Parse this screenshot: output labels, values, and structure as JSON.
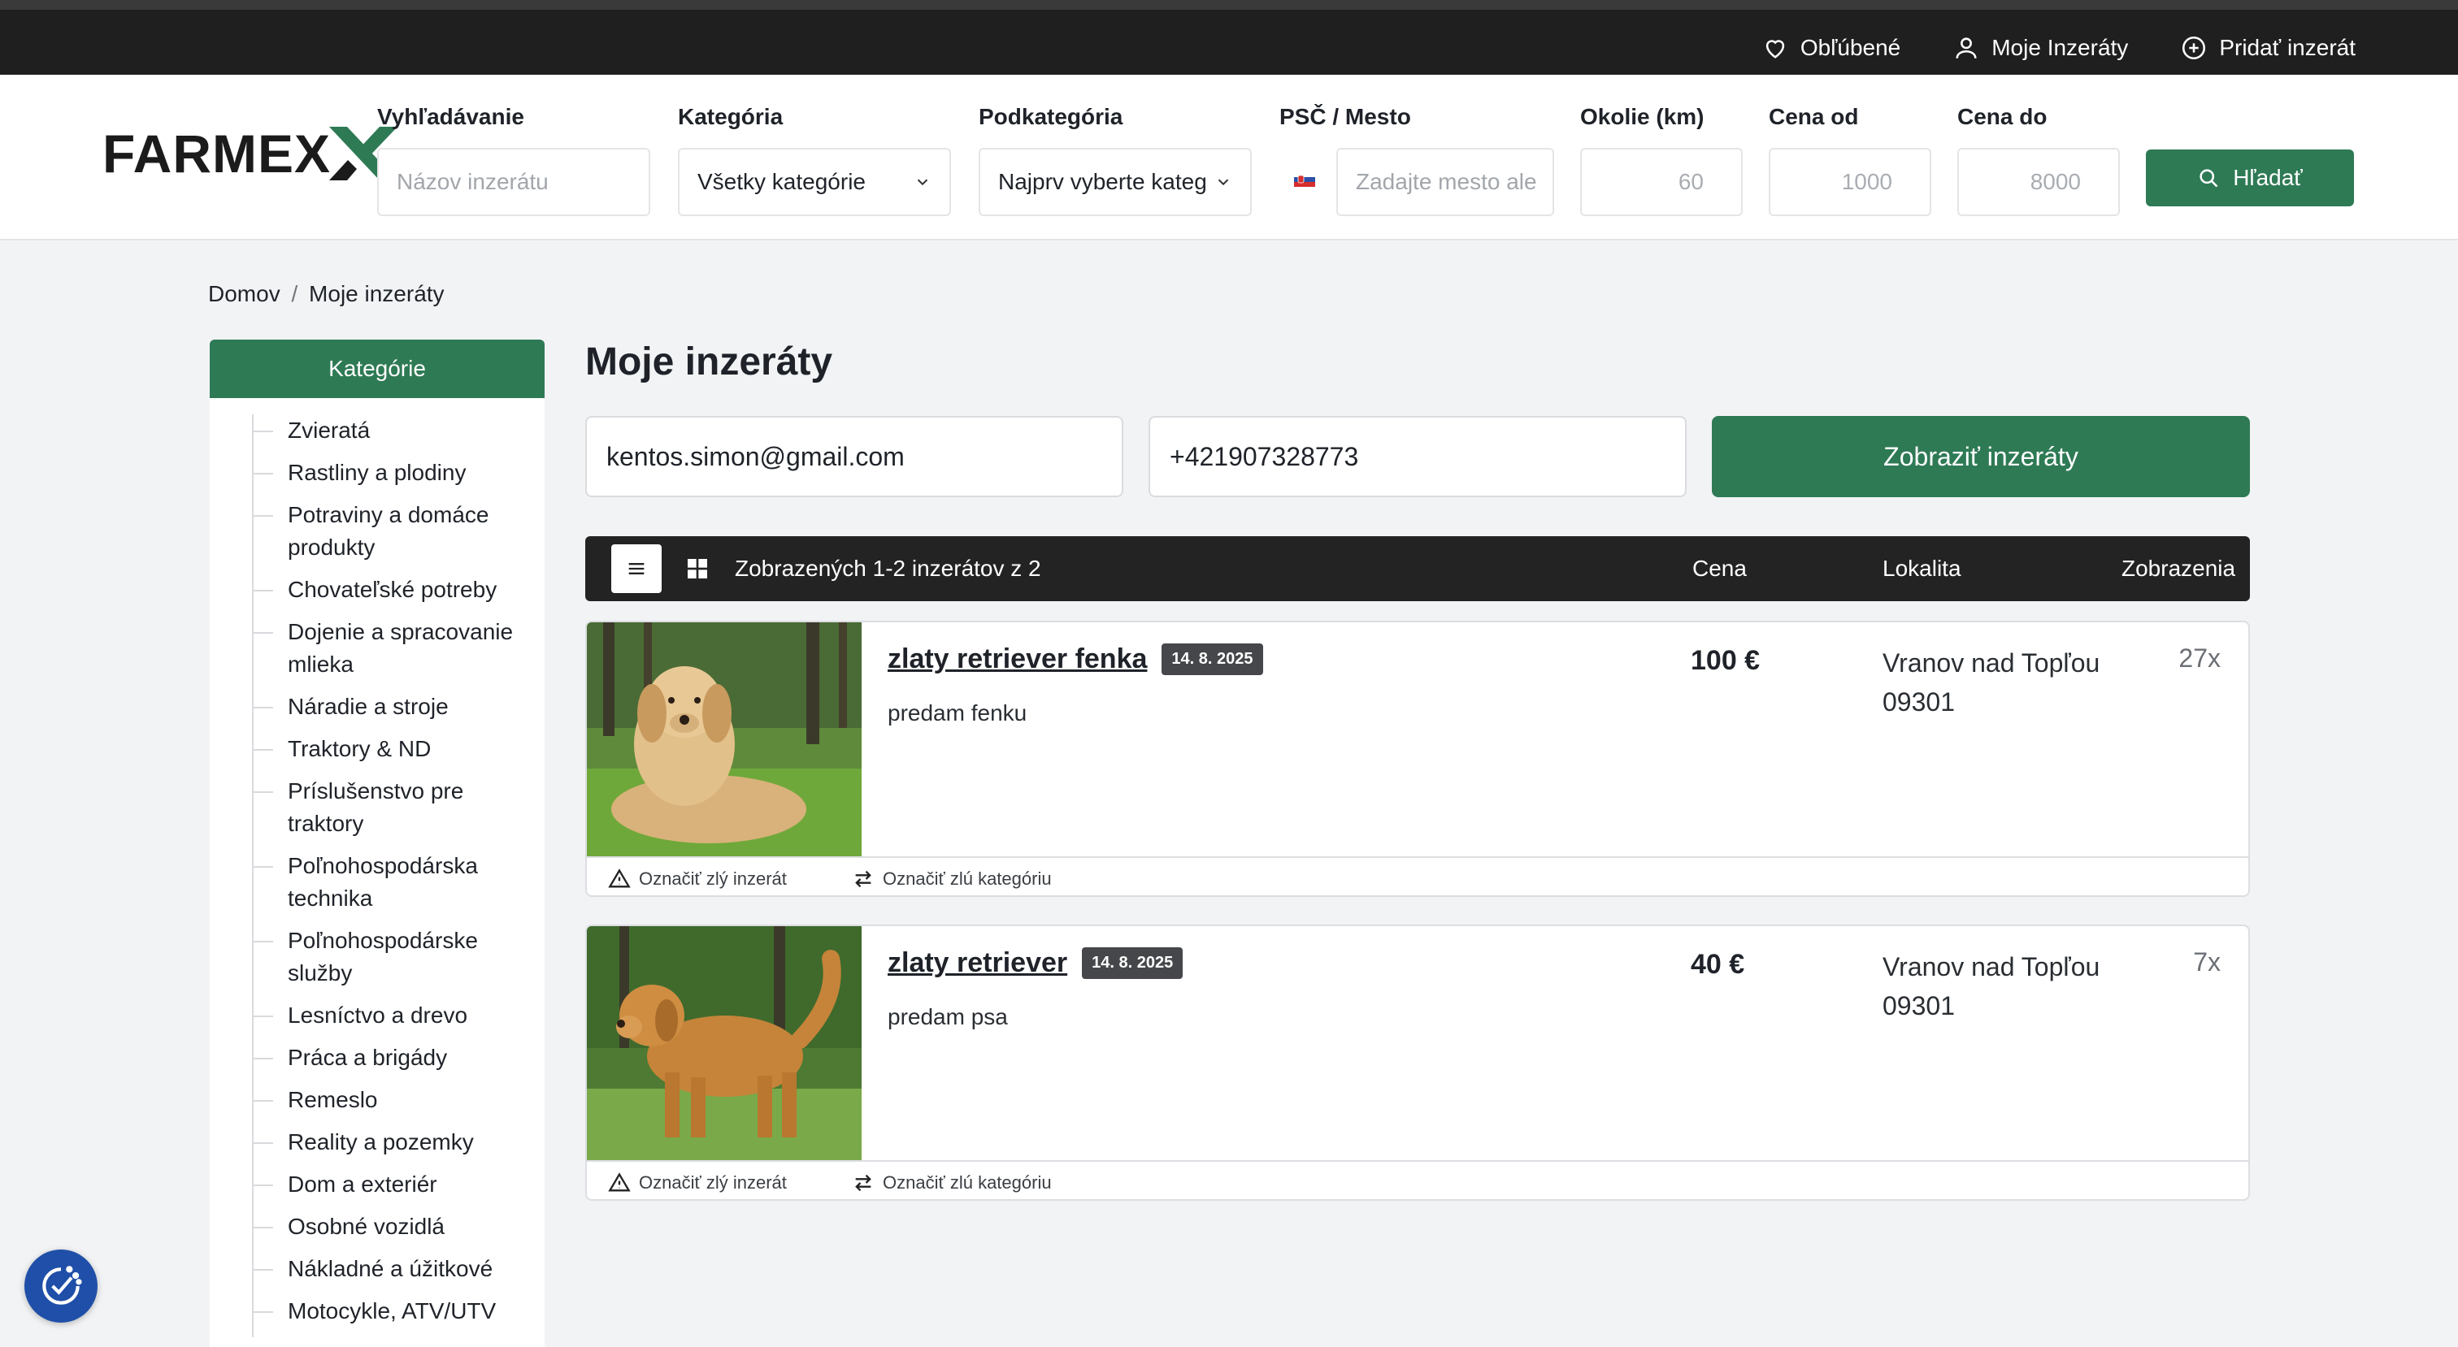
{
  "topnav": {
    "favorites": "Obľúbené",
    "my_ads": "Moje Inzeráty",
    "add_ad": "Pridať inzerát"
  },
  "logo": {
    "text": "FARMEX"
  },
  "search": {
    "query_label": "Vyhľadávanie",
    "query_placeholder": "Názov inzerátu",
    "category_label": "Kategória",
    "category_value": "Všetky kategórie",
    "subcategory_label": "Podkategória",
    "subcategory_value": "Najprv vyberte kateg",
    "location_label": "PSČ / Mesto",
    "location_placeholder": "Zadajte mesto ale",
    "radius_label": "Okolie (km)",
    "radius_placeholder": "60",
    "price_from_label": "Cena od",
    "price_from_placeholder": "1000",
    "price_to_label": "Cena do",
    "price_to_placeholder": "8000",
    "button": "Hľadať"
  },
  "breadcrumb": {
    "home": "Domov",
    "sep": "/",
    "current": "Moje inzeráty"
  },
  "sidebar": {
    "title": "Kategórie",
    "items": [
      "Zvieratá",
      "Rastliny a plodiny",
      "Potraviny a domáce produkty",
      "Chovateľské potreby",
      "Dojenie a spracovanie mlieka",
      "Náradie a stroje",
      "Traktory & ND",
      "Príslušenstvo pre traktory",
      "Poľnohospodárska technika",
      "Poľnohospodárske služby",
      "Lesníctvo a drevo",
      "Práca a brigády",
      "Remeslo",
      "Reality a pozemky",
      "Dom a exteriér",
      "Osobné vozidlá",
      "Nákladné a úžitkové",
      "Motocykle, ATV/UTV"
    ]
  },
  "main": {
    "title": "Moje inzeráty",
    "email_value": "kentos.simon@gmail.com",
    "phone_value": "+421907328773",
    "show_button": "Zobraziť inzeráty",
    "list_header": {
      "count": "Zobrazených 1-2 inzerátov z 2",
      "price": "Cena",
      "location": "Lokalita",
      "views": "Zobrazenia"
    },
    "listings": [
      {
        "title": "zlaty retriever fenka",
        "date": "14. 8. 2025",
        "desc": "predam fenku",
        "price": "100 €",
        "location": "Vranov nad Topľou 09301",
        "views": "27x",
        "report_ad": "Označiť zlý inzerát",
        "report_category": "Označiť zlú kategóriu"
      },
      {
        "title": "zlaty retriever",
        "date": "14. 8. 2025",
        "desc": "predam psa",
        "price": "40 €",
        "location": "Vranov nad Topľou 09301",
        "views": "7x",
        "report_ad": "Označiť zlý inzerát",
        "report_category": "Označiť zlú kategóriu"
      }
    ]
  },
  "colors": {
    "brand_green": "#2e7a55",
    "dark_bar": "#1f1f1f"
  }
}
